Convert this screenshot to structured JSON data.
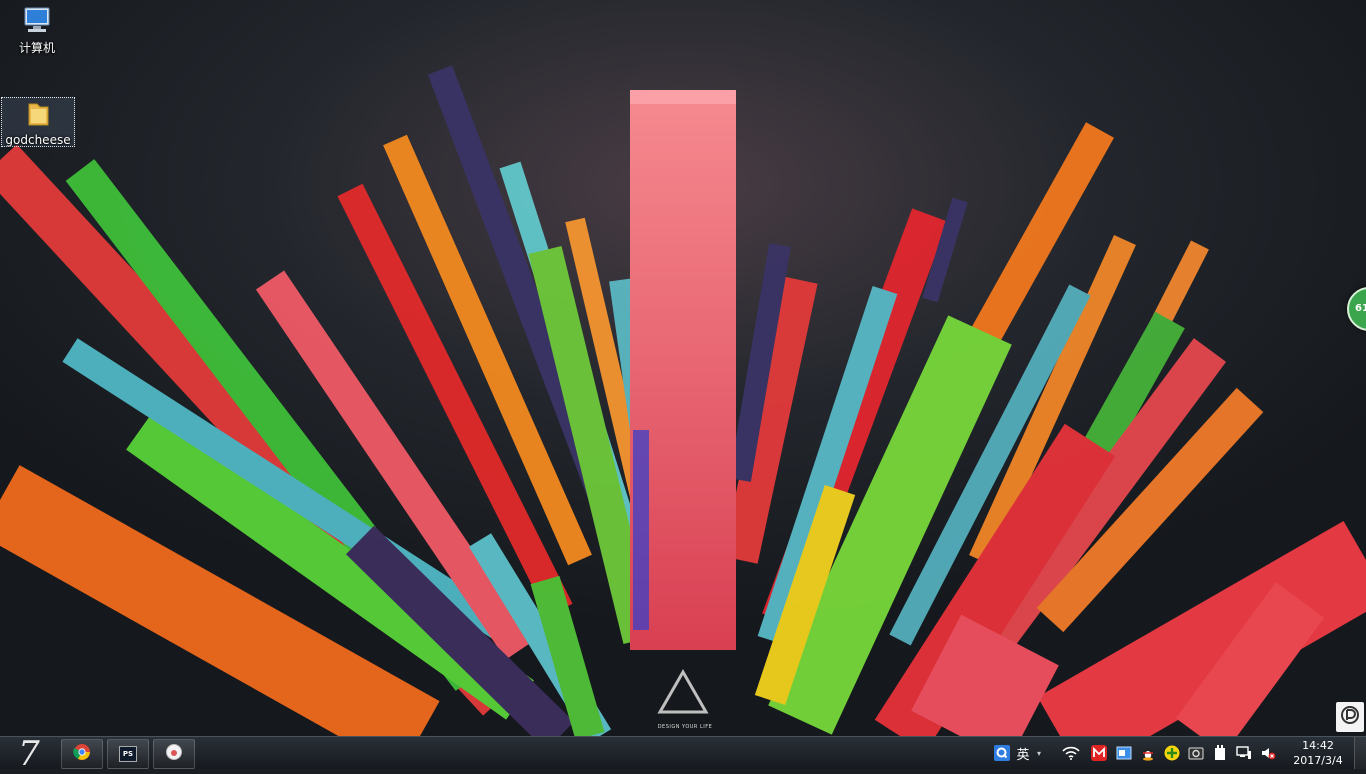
{
  "desktop": {
    "icons": [
      {
        "label": "计算机",
        "icon": "computer-icon"
      },
      {
        "label": "godcheese",
        "icon": "folder-icon"
      }
    ],
    "wallpaper_caption": "DESIGN YOUR LIFE",
    "floating_gauge": "61"
  },
  "taskbar": {
    "start_label": "7",
    "apps": [
      {
        "name": "chrome",
        "icon": "chrome-icon"
      },
      {
        "name": "photoshop",
        "icon": "ps-icon",
        "glyph": "PS"
      },
      {
        "name": "app",
        "icon": "app-icon"
      }
    ],
    "ime": {
      "icon": "ime-q-icon",
      "lang": "英",
      "arrow": "▾"
    },
    "tray_icons": [
      "wifi-icon",
      "m-icon",
      "window-icon",
      "qq-penguin-icon",
      "plus-icon",
      "camera-icon",
      "battery-icon",
      "network-icon",
      "volume-muted-icon"
    ],
    "clock": {
      "time": "14:42",
      "date": "2017/3/4"
    }
  },
  "colors": {
    "taskbar": "#1c2127",
    "wallpaper_bg": "#1b1f24",
    "accent_pink": "#f0707a",
    "gauge": "#3aa54c"
  }
}
